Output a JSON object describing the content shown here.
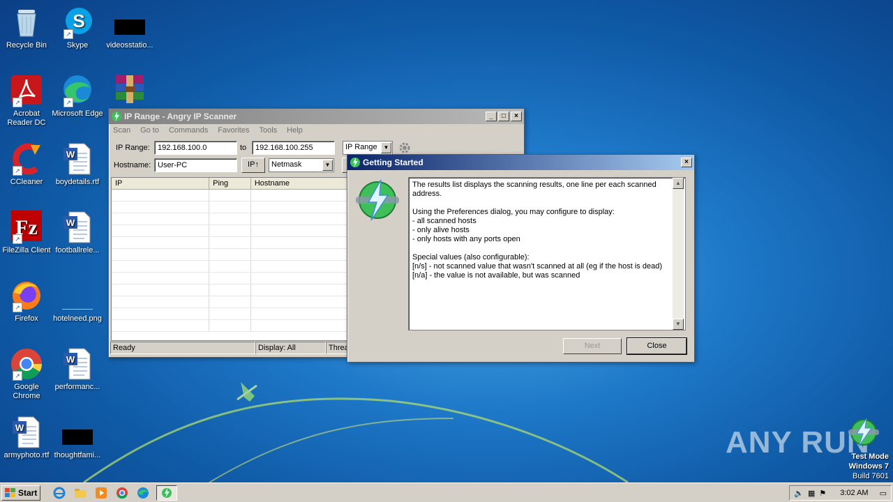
{
  "desktop": {
    "icons": [
      {
        "label": "Recycle Bin",
        "icon": "recycle-bin-icon"
      },
      {
        "label": "Skype",
        "icon": "skype-icon"
      },
      {
        "label": "videosstatio...",
        "icon": "black-file-icon"
      },
      {
        "label": "Acrobat Reader DC",
        "icon": "acrobat-icon"
      },
      {
        "label": "Microsoft Edge",
        "icon": "edge-icon"
      },
      {
        "label": "",
        "icon": "winrar-icon"
      },
      {
        "label": "CCleaner",
        "icon": "ccleaner-icon"
      },
      {
        "label": "boydetails.rtf",
        "icon": "word-doc-icon"
      },
      {
        "label": "FileZilla Client",
        "icon": "filezilla-icon"
      },
      {
        "label": "footballrele...",
        "icon": "word-doc-icon"
      },
      {
        "label": "Firefox",
        "icon": "firefox-icon"
      },
      {
        "label": "hotelneed.png",
        "icon": "png-file-icon"
      },
      {
        "label": "Google Chrome",
        "icon": "chrome-icon"
      },
      {
        "label": "performanc...",
        "icon": "word-doc-icon"
      },
      {
        "label": "armyphoto.rtf",
        "icon": "word-doc-icon"
      },
      {
        "label": "thoughtfami...",
        "icon": "black-file-icon"
      }
    ]
  },
  "scanner": {
    "title": "IP Range - Angry IP Scanner",
    "menu": [
      "Scan",
      "Go to",
      "Commands",
      "Favorites",
      "Tools",
      "Help"
    ],
    "ip_range_label": "IP Range:",
    "ip_from": "192.168.100.0",
    "to_label": "to",
    "ip_to": "192.168.100.255",
    "feeder_select": "IP Range",
    "hostname_label": "Hostname:",
    "hostname": "User-PC",
    "ip_button": "IP↑",
    "netmask_select": "Netmask",
    "columns": [
      "IP",
      "Ping",
      "Hostname"
    ],
    "status": {
      "ready": "Ready",
      "display": "Display: All",
      "threads": "Threa"
    }
  },
  "dialog": {
    "title": "Getting Started",
    "text": "The results list displays the scanning results, one line per each scanned address.\n\nUsing the Preferences dialog, you may configure to display:\n- all scanned hosts\n- only alive hosts\n- only hosts with any ports open\n\nSpecial values (also configurable):\n[n/s] - not scanned value that wasn't scanned at all (eg if the host is dead)\n[n/a] - the value is not available, but was scanned",
    "next_label": "Next",
    "close_label": "Close"
  },
  "taskbar": {
    "start_label": "Start",
    "clock": "3:02 AM"
  },
  "watermark": "ANY RUN",
  "os_info": {
    "line1": "Test Mode",
    "line2": "Windows 7",
    "line3": "Build 7601"
  },
  "colors": {
    "desktop_blue": "#1e78c8",
    "active_title": "#0a246a",
    "window_gray": "#d4d0c8"
  }
}
